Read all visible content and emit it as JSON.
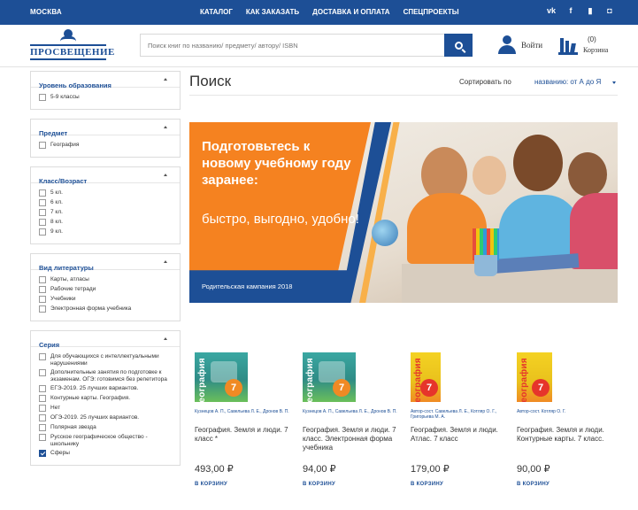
{
  "topbar": {
    "city": "МОСКВА",
    "nav": [
      "КАТАЛОГ",
      "КАК ЗАКАЗАТЬ",
      "ДОСТАВКА И ОПЛАТА",
      "СПЕЦПРОЕКТЫ"
    ],
    "social": [
      "vk-icon",
      "facebook-icon",
      "youtube-icon",
      "instagram-icon"
    ]
  },
  "header": {
    "logo_name": "ПРОСВЕЩЕНИЕ",
    "search_placeholder": "Поиск книг по названию/ предмету/ автору/ ISBN",
    "login": "Войти",
    "cart_count": "(0)",
    "cart_label": "Корзина"
  },
  "sidebar": {
    "facets": [
      {
        "title": "Уровень образования",
        "options": [
          {
            "label": "5-9 классы",
            "checked": false
          }
        ]
      },
      {
        "title": "Предмет",
        "options": [
          {
            "label": "География",
            "checked": false
          }
        ]
      },
      {
        "title": "Класс/Возраст",
        "options": [
          {
            "label": "5 кл.",
            "checked": false
          },
          {
            "label": "6 кл.",
            "checked": false
          },
          {
            "label": "7 кл.",
            "checked": false
          },
          {
            "label": "8 кл.",
            "checked": false
          },
          {
            "label": "9 кл.",
            "checked": false
          }
        ]
      },
      {
        "title": "Вид литературы",
        "options": [
          {
            "label": "Карты, атласы",
            "checked": false
          },
          {
            "label": "Рабочие тетради",
            "checked": false
          },
          {
            "label": "Учебники",
            "checked": false
          },
          {
            "label": "Электронная форма учебника",
            "checked": false
          }
        ]
      },
      {
        "title": "Серия",
        "options": [
          {
            "label": "Для обучающихся с интеллектуальными нарушениями",
            "checked": false
          },
          {
            "label": "Дополнительные занятия по подготовке к экзаменам. ОГЭ: готовимся без репетитора",
            "checked": false
          },
          {
            "label": "ЕГЭ-2019. 25 лучших вариантов.",
            "checked": false
          },
          {
            "label": "Контурные карты. География.",
            "checked": false
          },
          {
            "label": "Нет",
            "checked": false
          },
          {
            "label": "ОГЭ-2019. 25 лучших вариантов.",
            "checked": false
          },
          {
            "label": "Полярная звезда",
            "checked": false
          },
          {
            "label": "Русское географическое общество - школьнику",
            "checked": false
          },
          {
            "label": "Сферы",
            "checked": true
          }
        ]
      }
    ]
  },
  "main": {
    "title": "Поиск",
    "sort_label": "Сортировать по",
    "sort_value": "названию: от А до Я",
    "banner": {
      "headline": "Подготовьтесь к новому учебному году заранее:",
      "sub": "быстро, выгодно, удобно!",
      "campaign": "Родительская кампания 2018"
    },
    "products": [
      {
        "cover_title": "География",
        "badge": "7",
        "authors": "Кузнецов А. П., Савельева Л. Е., Дронов В. П.",
        "title": "География. Земля и люди. 7 класс *",
        "price": "493,00 ₽",
        "cta": "В КОРЗИНУ"
      },
      {
        "cover_title": "География",
        "badge": "7",
        "authors": "Кузнецов А. П., Савельева Л. Е., Дронов В. П.",
        "title": "География. Земля и люди. 7 класс. Электронная форма учебника",
        "price": "94,00 ₽",
        "cta": "В КОРЗИНУ"
      },
      {
        "cover_title": "География",
        "badge": "7",
        "authors": "Автор-сост. Савельева Л. Е., Котляр О. Г., Григорьева М. А.",
        "title": "География. Земля и люди. Атлас. 7 класс",
        "price": "179,00 ₽",
        "cta": "В КОРЗИНУ"
      },
      {
        "cover_title": "География",
        "badge": "7",
        "authors": "Автор-сост. Котляр О. Г.",
        "title": "География. Земля и люди. Контурные карты. 7 класс.",
        "price": "90,00 ₽",
        "cta": "В КОРЗИНУ"
      }
    ]
  }
}
